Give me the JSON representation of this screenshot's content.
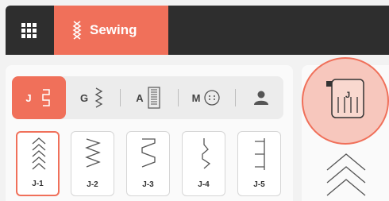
{
  "topbar": {
    "menu_icon": "grid-icon",
    "active_tab": {
      "label": "Sewing",
      "icon": "stitch-tab-icon"
    }
  },
  "categories": [
    {
      "letter": "J",
      "icon": "j-stitch-icon",
      "active": true
    },
    {
      "letter": "G",
      "icon": "g-stitch-icon",
      "active": false
    },
    {
      "letter": "A",
      "icon": "a-stitch-icon",
      "active": false
    },
    {
      "letter": "M",
      "icon": "m-stitch-icon",
      "active": false
    },
    {
      "letter": "",
      "icon": "user-icon",
      "active": false
    }
  ],
  "stitches": [
    {
      "code": "J-1",
      "selected": true
    },
    {
      "code": "J-2",
      "selected": false
    },
    {
      "code": "J-3",
      "selected": false
    },
    {
      "code": "J-4",
      "selected": false
    },
    {
      "code": "J-5",
      "selected": false
    }
  ],
  "presser_foot": {
    "letter": "J",
    "icon": "presser-foot-icon"
  },
  "colors": {
    "accent": "#f0705a",
    "topbar": "#2e2e2e",
    "foot_bg": "#f7c7bd"
  }
}
